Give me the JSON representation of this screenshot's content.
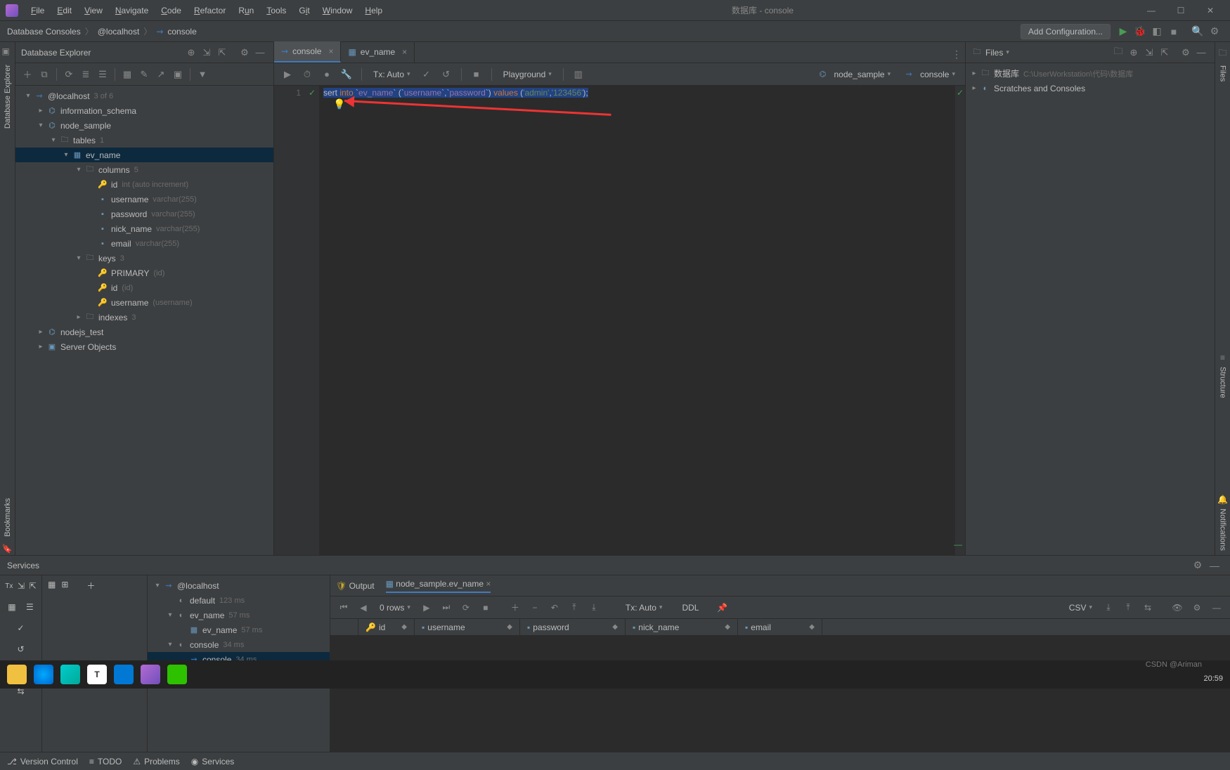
{
  "window": {
    "title": "数据库 - console"
  },
  "menu": [
    "File",
    "Edit",
    "View",
    "Navigate",
    "Code",
    "Refactor",
    "Run",
    "Tools",
    "Git",
    "Window",
    "Help"
  ],
  "breadcrumbs": [
    "Database Consoles",
    "@localhost",
    "console"
  ],
  "addConfig": "Add Configuration...",
  "dbExplorer": {
    "title": "Database Explorer",
    "host": "@localhost",
    "hostHint": "3 of 6",
    "schemas": [
      {
        "name": "information_schema"
      },
      {
        "name": "node_sample",
        "open": true,
        "tables": {
          "label": "tables",
          "count": "1",
          "items": [
            {
              "name": "ev_name",
              "open": true,
              "columns": {
                "label": "columns",
                "count": "5",
                "items": [
                  {
                    "name": "id",
                    "type": "int (auto increment)",
                    "pk": true
                  },
                  {
                    "name": "username",
                    "type": "varchar(255)"
                  },
                  {
                    "name": "password",
                    "type": "varchar(255)"
                  },
                  {
                    "name": "nick_name",
                    "type": "varchar(255)"
                  },
                  {
                    "name": "email",
                    "type": "varchar(255)"
                  }
                ]
              },
              "keys": {
                "label": "keys",
                "count": "3",
                "items": [
                  {
                    "name": "PRIMARY",
                    "hint": "(id)",
                    "pk": true
                  },
                  {
                    "name": "id",
                    "hint": "(id)"
                  },
                  {
                    "name": "username",
                    "hint": "(username)"
                  }
                ]
              },
              "indexes": {
                "label": "indexes",
                "count": "3"
              }
            }
          ]
        }
      },
      {
        "name": "nodejs_test"
      },
      {
        "name": "Server Objects",
        "serverObj": true
      }
    ]
  },
  "tabs": [
    {
      "name": "console",
      "active": true
    },
    {
      "name": "ev_name"
    }
  ],
  "editorToolbar": {
    "tx": "Tx: Auto",
    "playground": "Playground",
    "schema": "node_sample",
    "console": "console"
  },
  "code": {
    "line": "1",
    "sql": "sert into `ev_name` (`username`,`password`) values ('admin','123456');"
  },
  "filesPanel": {
    "title": "Files",
    "root": "数据库",
    "path": "C:\\UserWorkstation\\代码\\数据库",
    "scratch": "Scratches and Consoles"
  },
  "services": {
    "title": "Services",
    "tree": [
      {
        "name": "@localhost",
        "items": [
          {
            "name": "default",
            "hint": "123 ms"
          },
          {
            "name": "ev_name",
            "hint": "57 ms",
            "items": [
              {
                "name": "ev_name",
                "hint": "57 ms"
              }
            ]
          },
          {
            "name": "console",
            "hint": "34 ms",
            "items": [
              {
                "name": "console",
                "hint": "34 ms",
                "sel": true
              }
            ]
          }
        ]
      }
    ],
    "outTabs": [
      "Output",
      "node_sample.ev_name"
    ],
    "rows": "0 rows",
    "tx": "Tx: Auto",
    "ddl": "DDL",
    "csv": "CSV",
    "columns": [
      "id",
      "username",
      "password",
      "nick_name",
      "email"
    ]
  },
  "statusbar": [
    "Version Control",
    "TODO",
    "Problems",
    "Services"
  ],
  "watermark": "CSDN @Ariman",
  "clock": "20:59",
  "rails": {
    "left": "Database Explorer",
    "leftBookmarks": "Bookmarks",
    "rightFiles": "Files",
    "rightStructure": "Structure",
    "rightNotifications": "Notifications"
  }
}
